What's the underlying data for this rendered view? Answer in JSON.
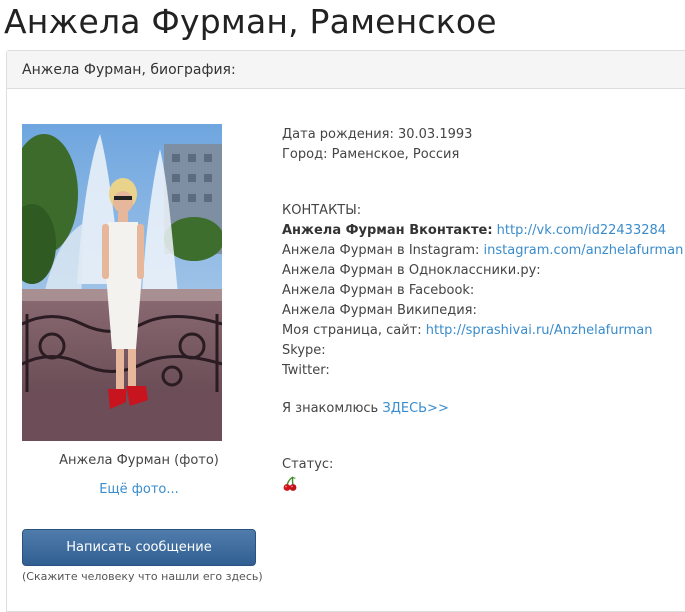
{
  "page": {
    "title": "Анжела Фурман, Раменское"
  },
  "panel": {
    "heading": "Анжела Фурман, биография:"
  },
  "photo": {
    "caption": "Анжела Фурман (фото)",
    "more_link": "Ещё фото..."
  },
  "message": {
    "button_label": "Написать сообщение",
    "hint": "(Скажите человеку что нашли его здесь)"
  },
  "info": {
    "birth_label": "Дата рождения: ",
    "birth_value": "30.03.1993",
    "city_label": "Город: ",
    "city_value": "Раменское, Россия",
    "contacts_heading": "КОНТАКТЫ:",
    "vk_label": "Анжела Фурман Вконтакте:",
    "vk_link": "http://vk.com/id22433284",
    "instagram_label": "Анжела Фурман в Instagram: ",
    "instagram_link": "instagram.com/anzhelafurman",
    "ok_label": "Анжела Фурман в Одноклассники.ру:",
    "facebook_label": "Анжела Фурман в Facebook:",
    "wiki_label": "Анжела Фурман Википедия:",
    "site_label": "Моя страница, сайт: ",
    "site_link": "http://sprashivai.ru/Anzhelafurman",
    "skype_label": "Skype:",
    "twitter_label": "Twitter:",
    "dating_label": "Я знакомлюсь ",
    "dating_link": "ЗДЕСЬ>>",
    "status_label": "Статус:",
    "status_icon": "cherries-icon"
  },
  "colors": {
    "link": "#3a8ccc",
    "button": "#3d6a9c",
    "panel_heading_bg": "#f5f5f5"
  }
}
